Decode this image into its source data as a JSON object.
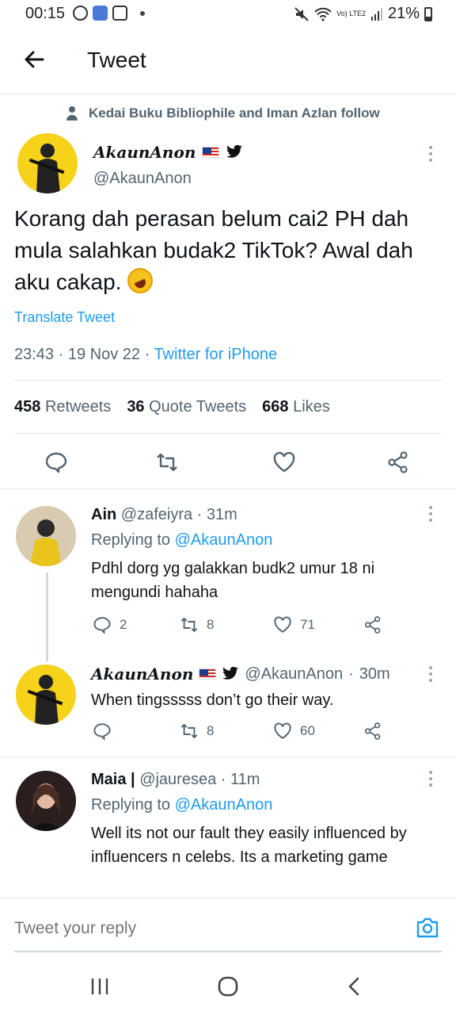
{
  "status_bar": {
    "time": "00:15",
    "network_label": "Vo) LTE2",
    "battery": "21%"
  },
  "header": {
    "title": "Tweet"
  },
  "social_context": "Kedai Buku Bibliophile and Iman Azlan follow",
  "main_tweet": {
    "display_name": "AkaunAnon",
    "handle": "@AkaunAnon",
    "text": "Korang dah perasan belum cai2 PH dah mula salahkan budak2 TikTok? Awal dah aku cakap.",
    "emoji": "rolling-on-floor-laughing",
    "translate_label": "Translate Tweet",
    "time": "23:43",
    "date": "19 Nov 22",
    "source": "Twitter for iPhone",
    "retweets_count": "458",
    "retweets_label": "Retweets",
    "quotes_count": "36",
    "quotes_label": "Quote Tweets",
    "likes_count": "668",
    "likes_label": "Likes"
  },
  "replies": [
    {
      "name": "Ain",
      "handle": "@zafeiyra",
      "time": "31m",
      "replying_prefix": "Replying to",
      "replying_to": "@AkaunAnon",
      "text": "Pdhl dorg yg galakkan budk2 umur 18 ni mengundi hahaha",
      "replies": "2",
      "retweets": "8",
      "likes": "71"
    },
    {
      "name": "AkaunAnon",
      "handle": "@AkaunAnon",
      "time": "30m",
      "text": "When tingsssss don’t go their way.",
      "retweets": "8",
      "likes": "60"
    },
    {
      "name": "Maia |",
      "handle": "@jauresea",
      "time": "11m",
      "replying_prefix": "Replying to",
      "replying_to": "@AkaunAnon",
      "text": "Well its not our fault they easily influenced by influencers n celebs. Its a marketing game"
    }
  ],
  "composer": {
    "placeholder": "Tweet your reply"
  },
  "colors": {
    "accent": "#1d9bf0",
    "secondary_text": "#536471",
    "primary_text": "#0f1419"
  }
}
